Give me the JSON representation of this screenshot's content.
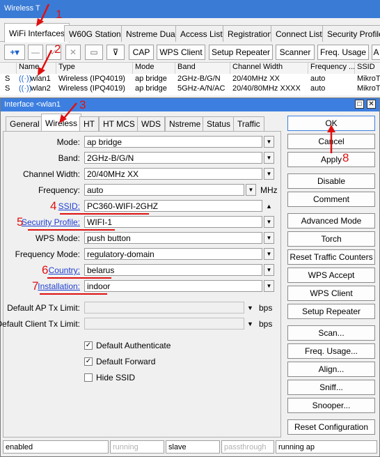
{
  "window": {
    "title": "Wireless T"
  },
  "outer_tabs": [
    "WiFi Interfaces",
    "W60G Station",
    "Nstreme Dual",
    "Access List",
    "Registration",
    "Connect List",
    "Security Profiles"
  ],
  "toolbar": {
    "buttons": [
      "CAP",
      "WPS Client",
      "Setup Repeater",
      "Scanner",
      "Freq. Usage",
      "A"
    ]
  },
  "table": {
    "headers": [
      "",
      "Name",
      "Type",
      "Mode",
      "Band",
      "Channel Width",
      "Frequency ...",
      "SSID"
    ],
    "rows": [
      [
        "S",
        "wlan1",
        "Wireless (IPQ4019)",
        "ap bridge",
        "2GHz-B/G/N",
        "20/40MHz XX",
        "auto",
        "MikroT"
      ],
      [
        "S",
        "wlan2",
        "Wireless (IPQ4019)",
        "ap bridge",
        "5GHz-A/N/AC",
        "20/40/80MHz XXXX",
        "auto",
        "MikroT"
      ]
    ]
  },
  "dialog": {
    "title": "Interface <wlan1",
    "tabs": [
      "General",
      "Wireless",
      "HT",
      "HT MCS",
      "WDS",
      "Nstreme",
      "Status",
      "Traffic"
    ],
    "fields": {
      "mode": {
        "label": "Mode:",
        "value": "ap bridge"
      },
      "band": {
        "label": "Band:",
        "value": "2GHz-B/G/N"
      },
      "channel_width": {
        "label": "Channel Width:",
        "value": "20/40MHz XX"
      },
      "frequency": {
        "label": "Frequency:",
        "value": "auto",
        "unit": "MHz"
      },
      "ssid": {
        "label": "SSID:",
        "value": "PC360-WIFI-2GHZ"
      },
      "security_profile": {
        "label": "Security Profile:",
        "value": "WIFI-1"
      },
      "wps_mode": {
        "label": "WPS Mode:",
        "value": "push button"
      },
      "frequency_mode": {
        "label": "Frequency Mode:",
        "value": "regulatory-domain"
      },
      "country": {
        "label": "Country:",
        "value": "belarus"
      },
      "installation": {
        "label": "Installation:",
        "value": "indoor"
      },
      "ap_tx_limit": {
        "label": "Default AP Tx Limit:",
        "value": "",
        "unit": "bps"
      },
      "client_tx_limit": {
        "label": "Default Client Tx Limit:",
        "value": "",
        "unit": "bps"
      }
    },
    "checkboxes": [
      {
        "label": "Default Authenticate",
        "checked": true
      },
      {
        "label": "Default Forward",
        "checked": true
      },
      {
        "label": "Hide SSID",
        "checked": false
      }
    ],
    "side_buttons": [
      "OK",
      "Cancel",
      "Apply",
      "Disable",
      "Comment",
      "Advanced Mode",
      "Torch",
      "Reset Traffic Counters",
      "WPS Accept",
      "WPS Client",
      "Setup Repeater",
      "Scan...",
      "Freq. Usage...",
      "Align...",
      "Sniff...",
      "Snooper...",
      "Reset Configuration"
    ],
    "status_bar": [
      "enabled",
      "running",
      "slave",
      "passthrough",
      "running ap"
    ]
  },
  "annotations": [
    "1",
    "2",
    "3",
    "4",
    "5",
    "6",
    "7",
    "8"
  ],
  "colors": {
    "annotation": "#e01010",
    "titlebar": "#3a7bd5",
    "link_label": "#1f3fd1"
  }
}
